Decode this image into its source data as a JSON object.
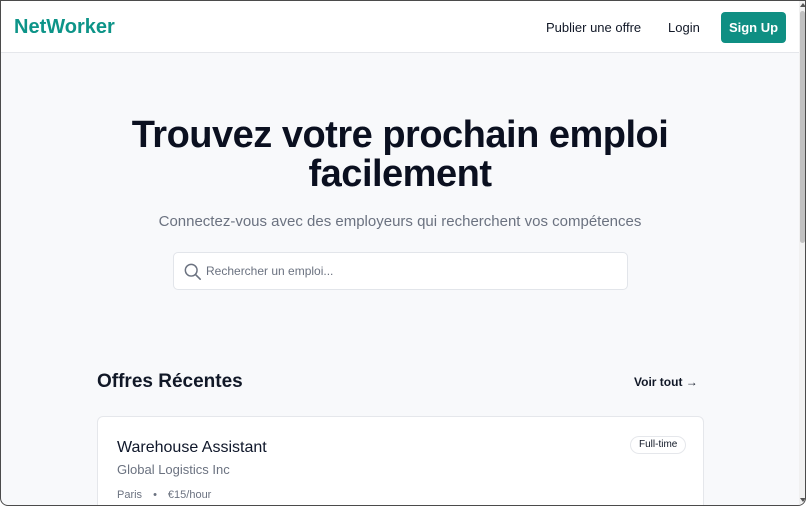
{
  "header": {
    "logo": "NetWorker",
    "nav": {
      "publish": "Publier une offre",
      "login": "Login",
      "signup": "Sign Up"
    }
  },
  "hero": {
    "title_line1": "Trouvez votre prochain emploi",
    "title_line2": "facilement",
    "subtitle": "Connectez-vous avec des employeurs qui recherchent vos compétences",
    "search": {
      "placeholder": "Rechercher un emploi...",
      "icon": "search-icon"
    }
  },
  "recent": {
    "title": "Offres Récentes",
    "see_all": "Voir tout →",
    "jobs": [
      {
        "title": "Warehouse Assistant",
        "company": "Global Logistics Inc",
        "type": "Full-time",
        "location": "Paris",
        "separator": "•",
        "salary": "€15/hour"
      }
    ]
  },
  "colors": {
    "brand": "#0d9488",
    "button": "#0f8f83",
    "background": "#f8f9fb"
  }
}
